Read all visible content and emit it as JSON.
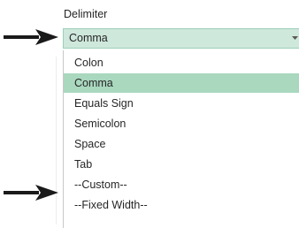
{
  "delimiter": {
    "label": "Delimiter",
    "selected_value": "Comma",
    "options": [
      {
        "label": "Colon"
      },
      {
        "label": "Comma",
        "selected": true
      },
      {
        "label": "Equals Sign"
      },
      {
        "label": "Semicolon"
      },
      {
        "label": "Space"
      },
      {
        "label": "Tab"
      },
      {
        "label": "--Custom--"
      },
      {
        "label": "--Fixed Width--"
      }
    ]
  },
  "colors": {
    "selected_option": "#a9d8bf",
    "select_background": "#cfe8dc",
    "arrow": "#1a1a1a"
  },
  "icons": {
    "dropdown": "chevron-down-icon",
    "callout": "arrow-right-icon"
  }
}
